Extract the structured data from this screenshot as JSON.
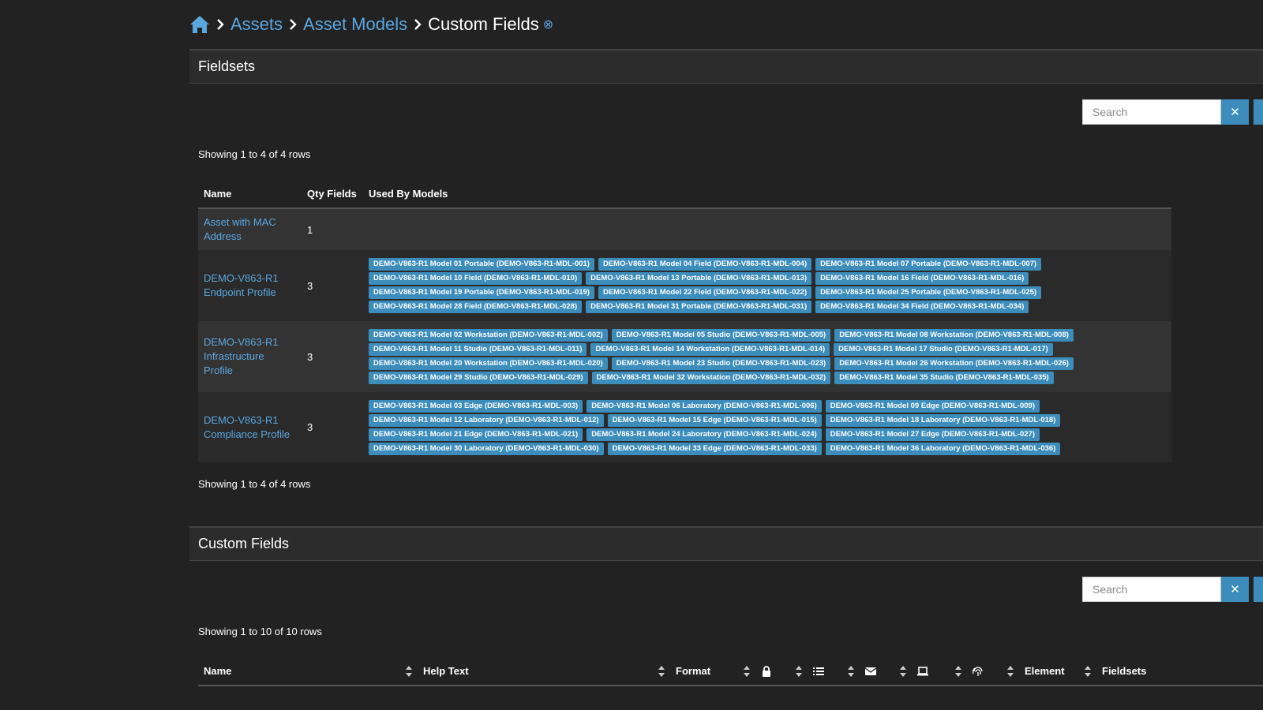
{
  "breadcrumb": {
    "home_icon": "home-icon",
    "items": [
      "Assets",
      "Asset Models"
    ],
    "current": "Custom Fields",
    "help_icon": "⊗"
  },
  "fieldsets": {
    "title": "Fieldsets",
    "search_placeholder": "Search",
    "clear_label": "✕",
    "showing": "Showing 1 to 4 of 4 rows",
    "columns": [
      "Name",
      "Qty Fields",
      "Used By Models"
    ],
    "rows": [
      {
        "name": "Asset with MAC Address",
        "qty": "1",
        "models": []
      },
      {
        "name": "DEMO-V863-R1 Endpoint Profile",
        "qty": "3",
        "models": [
          "DEMO-V863-R1 Model 01 Portable (DEMO-V863-R1-MDL-001)",
          "DEMO-V863-R1 Model 04 Field (DEMO-V863-R1-MDL-004)",
          "DEMO-V863-R1 Model 07 Portable (DEMO-V863-R1-MDL-007)",
          "DEMO-V863-R1 Model 10 Field (DEMO-V863-R1-MDL-010)",
          "DEMO-V863-R1 Model 13 Portable (DEMO-V863-R1-MDL-013)",
          "DEMO-V863-R1 Model 16 Field (DEMO-V863-R1-MDL-016)",
          "DEMO-V863-R1 Model 19 Portable (DEMO-V863-R1-MDL-019)",
          "DEMO-V863-R1 Model 22 Field (DEMO-V863-R1-MDL-022)",
          "DEMO-V863-R1 Model 25 Portable (DEMO-V863-R1-MDL-025)",
          "DEMO-V863-R1 Model 28 Field (DEMO-V863-R1-MDL-028)",
          "DEMO-V863-R1 Model 31 Portable (DEMO-V863-R1-MDL-031)",
          "DEMO-V863-R1 Model 34 Field (DEMO-V863-R1-MDL-034)"
        ]
      },
      {
        "name": "DEMO-V863-R1 Infrastructure Profile",
        "qty": "3",
        "models": [
          "DEMO-V863-R1 Model 02 Workstation (DEMO-V863-R1-MDL-002)",
          "DEMO-V863-R1 Model 05 Studio (DEMO-V863-R1-MDL-005)",
          "DEMO-V863-R1 Model 08 Workstation (DEMO-V863-R1-MDL-008)",
          "DEMO-V863-R1 Model 11 Studio (DEMO-V863-R1-MDL-011)",
          "DEMO-V863-R1 Model 14 Workstation (DEMO-V863-R1-MDL-014)",
          "DEMO-V863-R1 Model 17 Studio (DEMO-V863-R1-MDL-017)",
          "DEMO-V863-R1 Model 20 Workstation (DEMO-V863-R1-MDL-020)",
          "DEMO-V863-R1 Model 23 Studio (DEMO-V863-R1-MDL-023)",
          "DEMO-V863-R1 Model 26 Workstation (DEMO-V863-R1-MDL-026)",
          "DEMO-V863-R1 Model 29 Studio (DEMO-V863-R1-MDL-029)",
          "DEMO-V863-R1 Model 32 Workstation (DEMO-V863-R1-MDL-032)",
          "DEMO-V863-R1 Model 35 Studio (DEMO-V863-R1-MDL-035)"
        ]
      },
      {
        "name": "DEMO-V863-R1 Compliance Profile",
        "qty": "3",
        "models": [
          "DEMO-V863-R1 Model 03 Edge (DEMO-V863-R1-MDL-003)",
          "DEMO-V863-R1 Model 06 Laboratory (DEMO-V863-R1-MDL-006)",
          "DEMO-V863-R1 Model 09 Edge (DEMO-V863-R1-MDL-009)",
          "DEMO-V863-R1 Model 12 Laboratory (DEMO-V863-R1-MDL-012)",
          "DEMO-V863-R1 Model 15 Edge (DEMO-V863-R1-MDL-015)",
          "DEMO-V863-R1 Model 18 Laboratory (DEMO-V863-R1-MDL-018)",
          "DEMO-V863-R1 Model 21 Edge (DEMO-V863-R1-MDL-021)",
          "DEMO-V863-R1 Model 24 Laboratory (DEMO-V863-R1-MDL-024)",
          "DEMO-V863-R1 Model 27 Edge (DEMO-V863-R1-MDL-027)",
          "DEMO-V863-R1 Model 30 Laboratory (DEMO-V863-R1-MDL-030)",
          "DEMO-V863-R1 Model 33 Edge (DEMO-V863-R1-MDL-033)",
          "DEMO-V863-R1 Model 36 Laboratory (DEMO-V863-R1-MDL-036)"
        ]
      }
    ],
    "showing_bottom": "Showing 1 to 4 of 4 rows"
  },
  "custom_fields": {
    "title": "Custom Fields",
    "search_placeholder": "Search",
    "clear_label": "✕",
    "showing": "Showing 1 to 10 of 10 rows",
    "columns": {
      "name": "Name",
      "help_text": "Help Text",
      "format": "Format",
      "element": "Element",
      "fieldsets": "Fieldsets"
    },
    "icon_columns": [
      "lock-icon",
      "list-icon",
      "envelope-icon",
      "laptop-icon",
      "fingerprint-icon"
    ]
  },
  "colors": {
    "accent": "#3c8dbc",
    "link": "#5aa7e0",
    "background": "#222222"
  }
}
